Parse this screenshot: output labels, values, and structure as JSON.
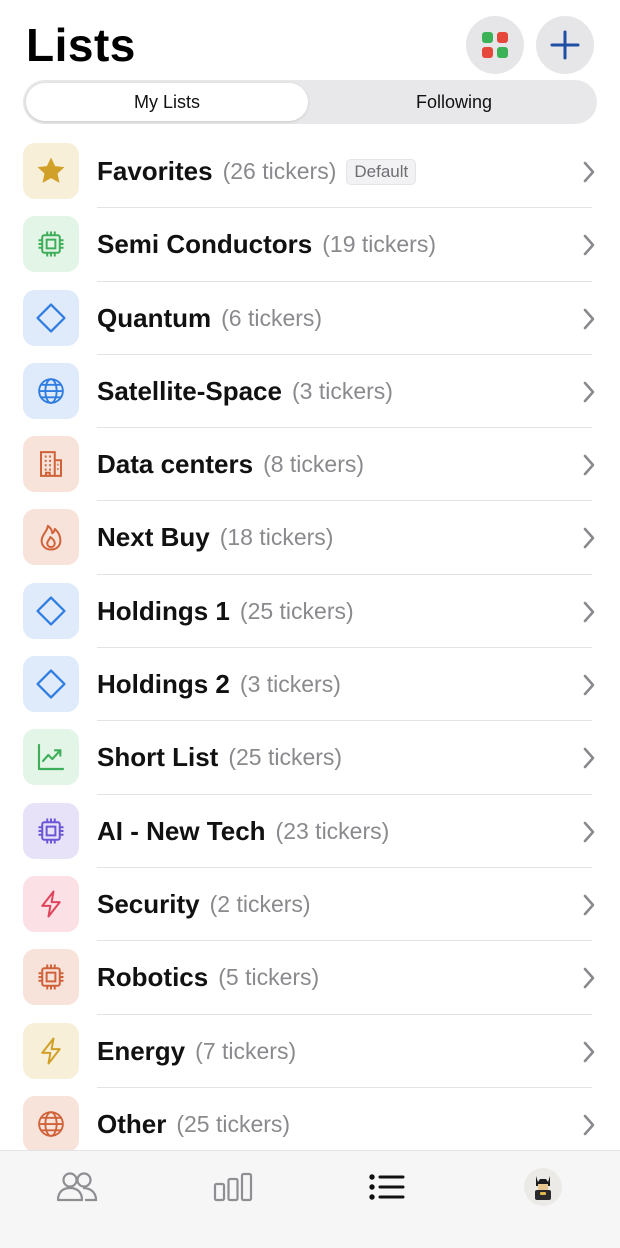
{
  "header": {
    "title": "Lists",
    "grid_icon": "app-grid-icon",
    "add_icon": "plus-icon"
  },
  "segments": {
    "my_lists": "My Lists",
    "following": "Following",
    "selected": "My Lists"
  },
  "lists": [
    {
      "name": "Favorites",
      "count": "(26 tickers)",
      "badge": "Default",
      "icon": "star-icon",
      "color": "#d1a028",
      "bg": "#f7efd8"
    },
    {
      "name": "Semi Conductors",
      "count": "(19 tickers)",
      "icon": "chip-icon",
      "color": "#3fae5a",
      "bg": "#e3f5e6"
    },
    {
      "name": "Quantum",
      "count": "(6 tickers)",
      "icon": "diamond-icon",
      "color": "#2f7de0",
      "bg": "#dfeafb"
    },
    {
      "name": "Satellite-Space",
      "count": "(3 tickers)",
      "icon": "globe-icon",
      "color": "#2f7de0",
      "bg": "#dfeafb"
    },
    {
      "name": "Data centers",
      "count": "(8 tickers)",
      "icon": "building-icon",
      "color": "#d0623a",
      "bg": "#f8e3db"
    },
    {
      "name": "Next Buy",
      "count": "(18 tickers)",
      "icon": "flame-icon",
      "color": "#d0623a",
      "bg": "#f8e3db"
    },
    {
      "name": "Holdings 1",
      "count": "(25 tickers)",
      "icon": "diamond-icon",
      "color": "#2f7de0",
      "bg": "#dfeafb"
    },
    {
      "name": "Holdings 2",
      "count": "(3 tickers)",
      "icon": "diamond-icon",
      "color": "#2f7de0",
      "bg": "#dfeafb"
    },
    {
      "name": "Short List",
      "count": "(25 tickers)",
      "icon": "chart-line-up-icon",
      "color": "#3fae5a",
      "bg": "#e3f5e6"
    },
    {
      "name": "AI - New Tech",
      "count": "(23 tickers)",
      "icon": "chip-icon",
      "color": "#6b56d6",
      "bg": "#e7e2f8"
    },
    {
      "name": "Security",
      "count": "(2 tickers)",
      "icon": "bolt-icon",
      "color": "#e0445c",
      "bg": "#fbe0e5"
    },
    {
      "name": "Robotics",
      "count": "(5 tickers)",
      "icon": "chip-icon",
      "color": "#d0623a",
      "bg": "#f8e3db"
    },
    {
      "name": "Energy",
      "count": "(7 tickers)",
      "icon": "bolt-icon",
      "color": "#d1a028",
      "bg": "#f7efd8"
    },
    {
      "name": "Other",
      "count": "(25 tickers)",
      "icon": "globe-icon",
      "color": "#d0623a",
      "bg": "#f8e3db"
    }
  ],
  "tabbar": {
    "items": [
      {
        "icon": "people-icon",
        "active": false
      },
      {
        "icon": "bar-chart-icon",
        "active": false
      },
      {
        "icon": "list-icon",
        "active": true
      },
      {
        "icon": "avatar-icon",
        "active": false
      }
    ]
  }
}
